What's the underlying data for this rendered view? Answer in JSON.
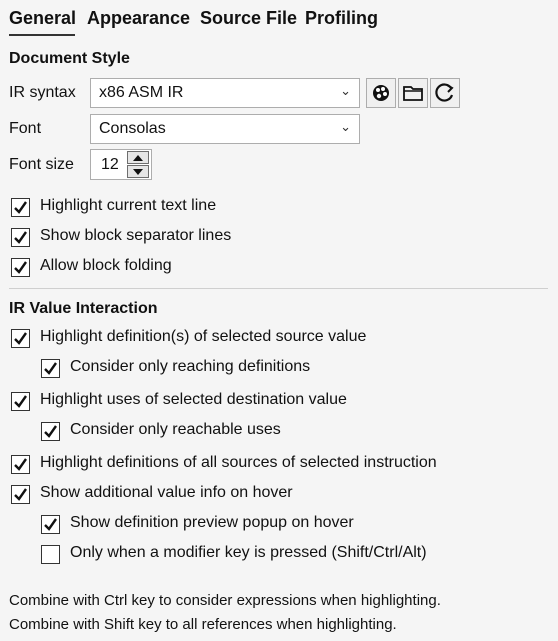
{
  "tabs": [
    {
      "label": "General"
    },
    {
      "label": "Appearance"
    },
    {
      "label": "Source File"
    },
    {
      "label": "Profiling"
    }
  ],
  "document_style": {
    "title": "Document Style",
    "ir_syntax_label": "IR syntax",
    "ir_syntax_value": "x86 ASM IR",
    "font_label": "Font",
    "font_value": "Consolas",
    "font_size_label": "Font size",
    "font_size_value": "12"
  },
  "toolbar_icons": [
    "palette-icon",
    "folder-icon",
    "refresh-icon"
  ],
  "display_options": [
    {
      "label": "Highlight current text line",
      "checked": true
    },
    {
      "label": "Show block separator lines",
      "checked": true
    },
    {
      "label": "Allow block folding",
      "checked": true
    }
  ],
  "ir_value_interaction": {
    "title": "IR Value Interaction",
    "options": [
      {
        "label": "Highlight definition(s) of selected source value",
        "checked": true
      },
      {
        "label": "Consider only reaching definitions",
        "checked": true
      },
      {
        "label": "Highlight uses of selected destination value",
        "checked": true
      },
      {
        "label": "Consider only reachable uses",
        "checked": true
      },
      {
        "label": "Highlight definitions of all sources of selected instruction",
        "checked": true
      },
      {
        "label": "Show additional value info on hover",
        "checked": true
      },
      {
        "label": "Show definition preview popup on hover",
        "checked": true
      },
      {
        "label": "Only when a modifier key is pressed (Shift/Ctrl/Alt)",
        "checked": false
      }
    ]
  },
  "notes": [
    "Combine with Ctrl key to consider expressions when highlighting.",
    "Combine with Shift key to all references when highlighting."
  ]
}
